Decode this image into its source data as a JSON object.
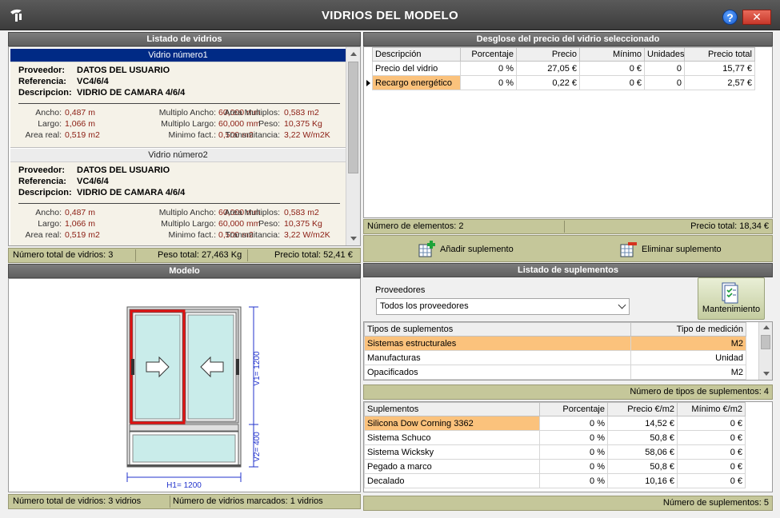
{
  "window": {
    "title": "VIDRIOS DEL MODELO",
    "help": "?",
    "close": "✕"
  },
  "glass_list": {
    "header": "Listado de vidrios",
    "labels": {
      "proveedor": "Proveedor:",
      "referencia": "Referencia:",
      "descripcion": "Descripcion:",
      "ancho": "Ancho:",
      "largo": "Largo:",
      "area_real": "Area real:",
      "multiplo_ancho": "Multiplo Ancho:",
      "multiplo_largo": "Multiplo Largo:",
      "minimo_fact": "Minimo fact.:",
      "area_multiplos": "Area Multiplos:",
      "peso": "Peso:",
      "transmitancia": "Transmitancia:"
    },
    "items": [
      {
        "title": "Vidrio número1",
        "proveedor": "DATOS DEL USUARIO",
        "referencia": "VC4/6/4",
        "descripcion": "VIDRIO DE CAMARA 4/6/4",
        "ancho": "0,487 m",
        "largo": "1,066 m",
        "area_real": "0,519 m2",
        "multiplo_ancho": "60,000 mm",
        "multiplo_largo": "60,000 mm",
        "minimo_fact": "0,500 m2",
        "area_multiplos": "0,583 m2",
        "peso": "10,375 Kg",
        "transmitancia": "3,22 W/m2K"
      },
      {
        "title": "Vidrio número2",
        "proveedor": "DATOS DEL USUARIO",
        "referencia": "VC4/6/4",
        "descripcion": "VIDRIO DE CAMARA 4/6/4",
        "ancho": "0,487 m",
        "largo": "1,066 m",
        "area_real": "0,519 m2",
        "multiplo_ancho": "60,000 mm",
        "multiplo_largo": "60,000 mm",
        "minimo_fact": "0,500 m2",
        "area_multiplos": "0,583 m2",
        "peso": "10,375 Kg",
        "transmitancia": "3,22 W/m2K"
      }
    ],
    "status": {
      "total_vidrios": "Número total de vidrios: 3",
      "peso_total": "Peso total: 27,463 Kg",
      "precio_total": "Precio total: 52,41 €"
    }
  },
  "model": {
    "header": "Modelo",
    "dims": {
      "h1": "H1= 1200",
      "v1": "V1= 1200",
      "v2": "V2= 400"
    },
    "status": {
      "total": "Número total de vidrios: 3 vidrios",
      "marcados": "Número de vidrios marcados: 1 vidrios"
    }
  },
  "price_breakdown": {
    "header": "Desglose del precio del vidrio seleccionado",
    "columns": [
      "Descripción",
      "Porcentaje",
      "Precio",
      "Mínimo",
      "Unidades",
      "Precio total"
    ],
    "rows": [
      [
        "Precio del vidrio",
        "0 %",
        "27,05 €",
        "0 €",
        "0",
        "15,77 €"
      ],
      [
        "Recargo energético",
        "0 %",
        "0,22 €",
        "0 €",
        "0",
        "2,57 €"
      ]
    ],
    "status": {
      "count": "Número de elementos: 2",
      "total": "Precio total: 18,34 €"
    },
    "add_label": "Añadir suplemento",
    "remove_label": "Eliminar suplemento"
  },
  "supplements": {
    "header": "Listado de suplementos",
    "providers_label": "Proveedores",
    "provider_selected": "Todos los proveedores",
    "maintenance_label": "Mantenimiento",
    "types_columns": [
      "Tipos de suplementos",
      "Tipo de medición"
    ],
    "types_rows": [
      [
        "Sistemas estructurales",
        "M2"
      ],
      [
        "Manufacturas",
        "Unidad"
      ],
      [
        "Opacificados",
        "M2"
      ]
    ],
    "types_status": "Número de tipos de suplementos: 4",
    "list_columns": [
      "Suplementos",
      "Porcentaje",
      "Precio €/m2",
      "Mínimo €/m2"
    ],
    "list_rows": [
      [
        "Silicona Dow Corning 3362",
        "0 %",
        "14,52 €",
        "0 €"
      ],
      [
        "Sistema Schuco",
        "0 %",
        "50,8 €",
        "0 €"
      ],
      [
        "Sistema Wicksky",
        "0 %",
        "58,06 €",
        "0 €"
      ],
      [
        "Pegado a marco",
        "0 %",
        "50,8 €",
        "0 €"
      ],
      [
        "Decalado",
        "0 %",
        "10,16 €",
        "0 €"
      ]
    ],
    "list_status": "Número de suplementos: 5"
  }
}
